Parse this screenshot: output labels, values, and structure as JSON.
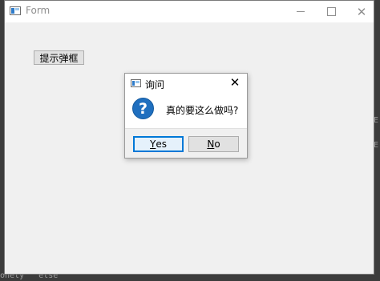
{
  "background": {
    "bottom_text": "onely   ^ else",
    "right_text_1": "E",
    "right_text_2": "E"
  },
  "window": {
    "title": "Form",
    "popup_button_label": "提示弹框"
  },
  "dialog": {
    "title": "询问",
    "message": "真的要这么做吗?",
    "icon": "question-icon",
    "buttons": {
      "yes": {
        "mnemonic": "Y",
        "rest": "es"
      },
      "no": {
        "mnemonic": "N",
        "rest": "o"
      }
    }
  },
  "colors": {
    "accent": "#0078d7",
    "question_icon": "#1f6fbf"
  }
}
